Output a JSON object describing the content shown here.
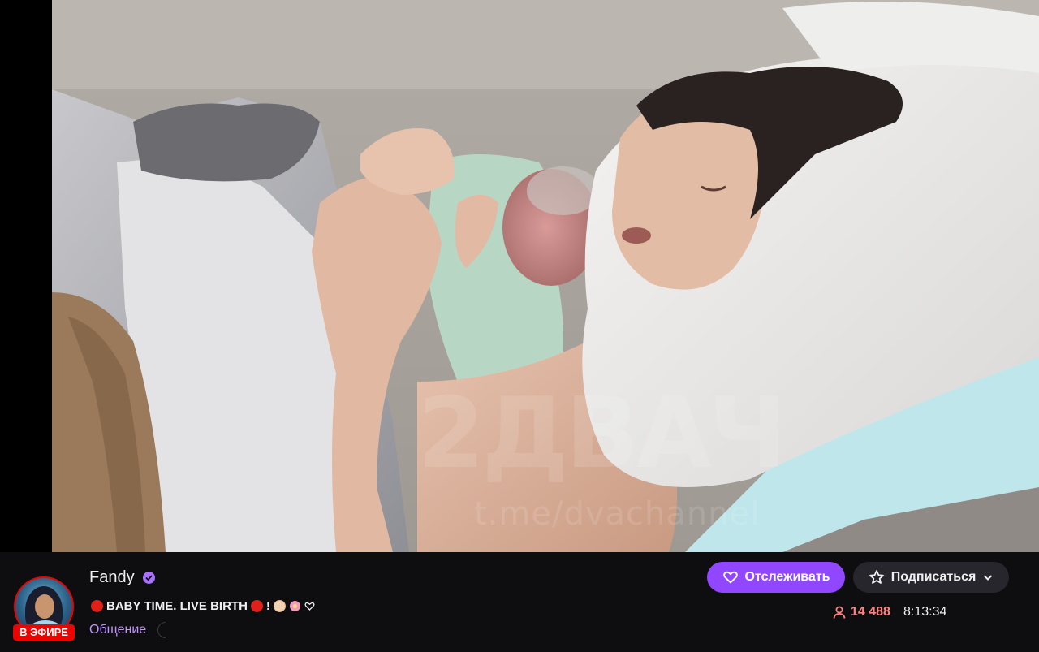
{
  "player": {
    "watermark_logo": "2ДВАЧ",
    "watermark_url": "t.me/dvachannel"
  },
  "channel": {
    "name": "Fandy",
    "verified": true,
    "live_badge": "В ЭФИРЕ",
    "title_text": "BABY TIME. LIVE BIRTH",
    "title_suffix": "!",
    "category": "Общение"
  },
  "actions": {
    "follow_label": "Отслеживать",
    "subscribe_label": "Подписаться"
  },
  "stats": {
    "viewers": "14 488",
    "uptime": "8:13:34"
  },
  "colors": {
    "accent": "#9147ff",
    "live": "#eb0400",
    "viewer_count": "#ff8280",
    "category_link": "#bf94ff",
    "background": "#0e0e10"
  },
  "icons": {
    "follow": "heart-outline-icon",
    "subscribe": "star-outline-icon",
    "dropdown": "chevron-down-icon",
    "viewers": "person-icon",
    "verified": "verified-check-icon"
  }
}
